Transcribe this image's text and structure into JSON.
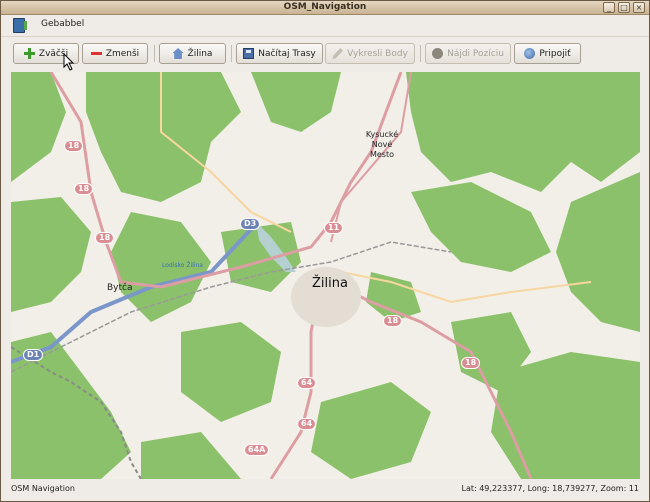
{
  "window": {
    "title": "OSM_Navigation",
    "minimize_glyph": "_",
    "maximize_glyph": "□",
    "close_glyph": "×"
  },
  "menubar": {
    "items": [
      "Gebabbel"
    ]
  },
  "toolbar": {
    "zoom_in": "Zväčši",
    "zoom_out": "Zmenši",
    "home": "Žilina",
    "load_tracks": "Načítaj Trasy",
    "draw_points": "Vykresli Body",
    "find_position": "Nájdi Pozíciu",
    "connect": "Pripojiť"
  },
  "map": {
    "cities": {
      "zilina": "Žilina",
      "bytca": "Bytča",
      "kysucke": "Kysucké Nové Mesto"
    },
    "water": "Lodisko Žilina",
    "roads": {
      "r18": "18",
      "r11": "11",
      "r64": "64",
      "r64a": "64A",
      "d1": "D1",
      "d3": "D3"
    },
    "colors": {
      "forest": "#8bc16a",
      "land": "#f2efe8",
      "road_primary": "#dc9ea3",
      "road_secondary": "#f8d6a0",
      "motorway": "#7b96c9",
      "railway": "#999999",
      "water": "#b5d0d0"
    }
  },
  "status": {
    "app_name": "OSM Navigation",
    "position": "Lat: 49,223377, Long: 18,739277, Zoom: 11"
  }
}
